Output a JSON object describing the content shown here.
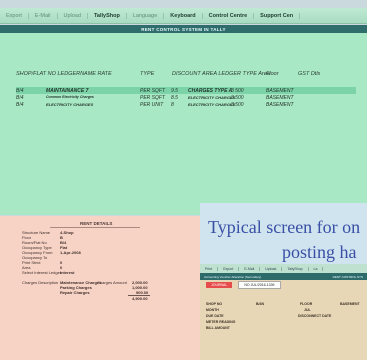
{
  "toolbar": {
    "items": [
      "Export",
      "E-Mail",
      "Upload",
      "TallyShop",
      "Language",
      "Keyboard",
      "Control Centre",
      "Support Cen"
    ]
  },
  "main": {
    "title": "RENT CONTROL SYSTEM IN TALLY",
    "columns": [
      "SHOP/FLAT NO",
      "LEDGERNAME",
      "RATE",
      "TYPE",
      "DISCOUNT AREA",
      "LEDGER TYPE",
      "Area",
      "Floor",
      "GST Dtls"
    ],
    "rows": [
      {
        "shop": "B/4",
        "ledger": "MAINTAINANCE 7",
        "type": "PER SQFT",
        "rate": "9.5",
        "ledgertype": "CHARGES TYPE A",
        "area": "3 500",
        "floor": "BASEMENT"
      },
      {
        "shop": "B/4",
        "ledger": "Common Electricity Charges",
        "type": "PER SQFT",
        "rate": "8.5",
        "ledgertype": "ELECTRICITY CHARGES",
        "area": "3 500",
        "floor": "BASEMENT"
      },
      {
        "shop": "B/4",
        "ledger": "ELECTRICITY CHARGES",
        "type": "PER UNIT",
        "rate": "8",
        "ledgertype": "ELECTRICITY CHARGES",
        "area": "3 500",
        "floor": "BASEMENT"
      }
    ]
  },
  "rent_details": {
    "title": "RENT DETAILS",
    "fields": [
      {
        "label": "Structure Name",
        "value": "4-Shop"
      },
      {
        "label": "Floor",
        "value": "B"
      },
      {
        "label": "Room/Flat No",
        "value": "B/4"
      },
      {
        "label": "Occupancy Type",
        "value": "Flat"
      },
      {
        "label": "Occupancy From",
        "value": "1-Apr-2008"
      },
      {
        "label": "Occupancy To",
        "value": ""
      },
      {
        "label": "Print Strict",
        "value": "0"
      },
      {
        "label": "Area",
        "value": "0"
      },
      {
        "label": "Select Interest Ledger",
        "value": "Interest"
      }
    ],
    "charges_label": "Charges Description",
    "charges_head": "Charges Amount",
    "charges": [
      {
        "name": "Maintenance Charges",
        "amount": "2,000.00"
      },
      {
        "name": "Parking Charges",
        "amount": "1,000.00"
      },
      {
        "name": "Repair Charges",
        "amount": "900.00"
      }
    ],
    "total": "4,900.00"
  },
  "overlay": {
    "line1": "Typical screen for on",
    "line2": "posting ha"
  },
  "mini": {
    "toolbar": [
      "Print",
      "Export",
      "E-Mail",
      "Upload",
      "TallyShop",
      "La"
    ],
    "bar_left": "Accounting Voucher Alteration (Secondary)",
    "bar_right": "RENT CONTROL SYS",
    "voucher": "JOURNAL",
    "voucher_no": "NO JUL/2016-1339",
    "shop_label": "SHOP NO",
    "shop_val": "B/4N",
    "floor_label": "FLOOR",
    "floor_val": "BASEMENT",
    "month_label": "MONTH",
    "month_val": "JUL",
    "due_label": "DUE DATE",
    "due_val": "DISCONNECT DATE",
    "meter_label": "METER READING",
    "bill_label": "BILL AMOUNT"
  },
  "colors": {
    "green_pane": "#a9e8c4",
    "highlight": "#7cd3a8",
    "pink_pane": "#f7d3c6",
    "headline": "#3a4fa5"
  }
}
